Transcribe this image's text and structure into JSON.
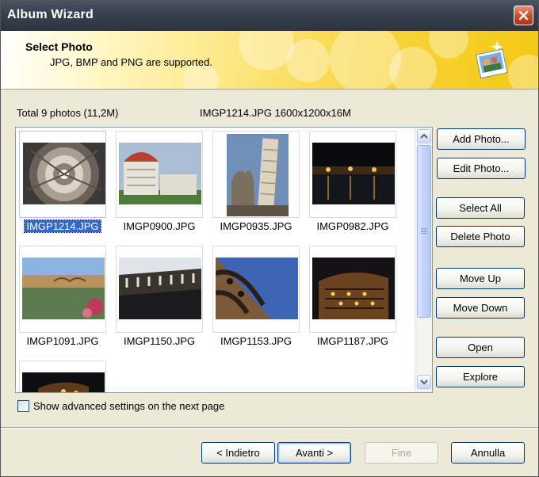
{
  "window": {
    "title": "Album Wizard"
  },
  "header": {
    "title": "Select Photo",
    "subtitle": "JPG, BMP and PNG are supported."
  },
  "info": {
    "total": "Total 9 photos (11,2M)",
    "selected_details": "IMGP1214.JPG  1600x1200x16M"
  },
  "photos": [
    {
      "name": "IMGP1214.JPG",
      "selected": true,
      "subject": "dome-interior"
    },
    {
      "name": "IMGP0900.JPG",
      "selected": false,
      "subject": "cathedral"
    },
    {
      "name": "IMGP0935.JPG",
      "selected": false,
      "subject": "leaning-tower"
    },
    {
      "name": "IMGP0982.JPG",
      "selected": false,
      "subject": "night-river"
    },
    {
      "name": "IMGP1091.JPG",
      "selected": false,
      "subject": "bridge"
    },
    {
      "name": "IMGP1150.JPG",
      "selected": false,
      "subject": "colosseum-interior"
    },
    {
      "name": "IMGP1153.JPG",
      "selected": false,
      "subject": "arches"
    },
    {
      "name": "IMGP1187.JPG",
      "selected": false,
      "subject": "colosseum-night"
    },
    {
      "name": "",
      "selected": false,
      "subject": "colosseum-partial"
    }
  ],
  "side_buttons": {
    "add_photo": "Add Photo...",
    "edit_photo": "Edit Photo...",
    "select_all": "Select All",
    "delete_photo": "Delete Photo",
    "move_up": "Move Up",
    "move_down": "Move Down",
    "open": "Open",
    "explore": "Explore"
  },
  "advanced": {
    "label": "Show advanced settings on the next page",
    "checked": false
  },
  "footer": {
    "back": "< Indietro",
    "next": "Avanti >",
    "finish": "Fine",
    "cancel": "Annulla"
  },
  "colors": {
    "selection": "#316ac5",
    "header_yellow": "#f3c815",
    "titlebar": "#3a4150"
  }
}
